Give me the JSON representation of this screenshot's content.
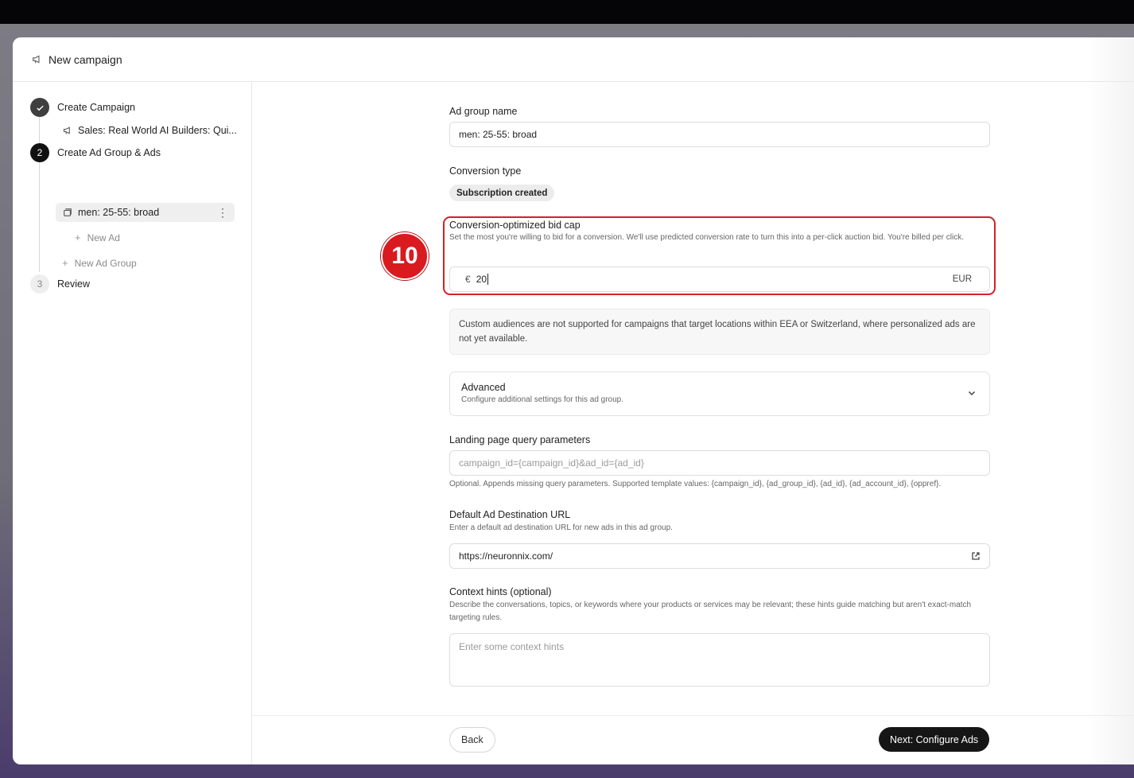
{
  "modal": {
    "title": "New campaign",
    "title_icon": "megaphone-icon"
  },
  "sidebar": {
    "steps": [
      {
        "number": "✓",
        "label": "Create Campaign",
        "state": "done"
      },
      {
        "number": "2",
        "label": "Create Ad Group & Ads",
        "state": "active"
      },
      {
        "number": "3",
        "label": "Review",
        "state": "pending"
      }
    ],
    "campaign_item": "Sales: Real World AI Builders: Qui...",
    "ad_group_item": "men: 25-55: broad",
    "new_ad": "New Ad",
    "new_ad_group": "New Ad Group"
  },
  "form": {
    "ad_group_name": {
      "label": "Ad group name",
      "value": "men: 25-55: broad"
    },
    "conversion_type": {
      "label": "Conversion type",
      "value": "Subscription created"
    },
    "bid_cap": {
      "label": "Conversion-optimized bid cap",
      "help": "Set the most you're willing to bid for a conversion. We'll use predicted conversion rate to turn this into a per-click auction bid. You're billed per click.",
      "currency_symbol": "€",
      "value": "20",
      "currency": "EUR"
    },
    "notice": "Custom audiences are not supported for campaigns that target locations within EEA or Switzerland, where personalized ads are not yet available.",
    "advanced": {
      "title": "Advanced",
      "subtitle": "Configure additional settings for this ad group."
    },
    "query_params": {
      "label": "Landing page query parameters",
      "placeholder": "campaign_id={campaign_id}&ad_id={ad_id}",
      "help": "Optional. Appends missing query parameters. Supported template values: {campaign_id}, {ad_group_id}, {ad_id}, {ad_account_id}, {oppref}."
    },
    "destination_url": {
      "label": "Default Ad Destination URL",
      "help": "Enter a default ad destination URL for new ads in this ad group.",
      "value": "https://neuronnix.com/"
    },
    "context_hints": {
      "label": "Context hints (optional)",
      "help": "Describe the conversations, topics, or keywords where your products or services may be relevant; these hints guide matching but aren't exact-match targeting rules.",
      "placeholder": "Enter some context hints"
    }
  },
  "annotation": {
    "badge": "10",
    "color": "#d91a1f"
  },
  "footer": {
    "back": "Back",
    "next": "Next: Configure Ads"
  }
}
